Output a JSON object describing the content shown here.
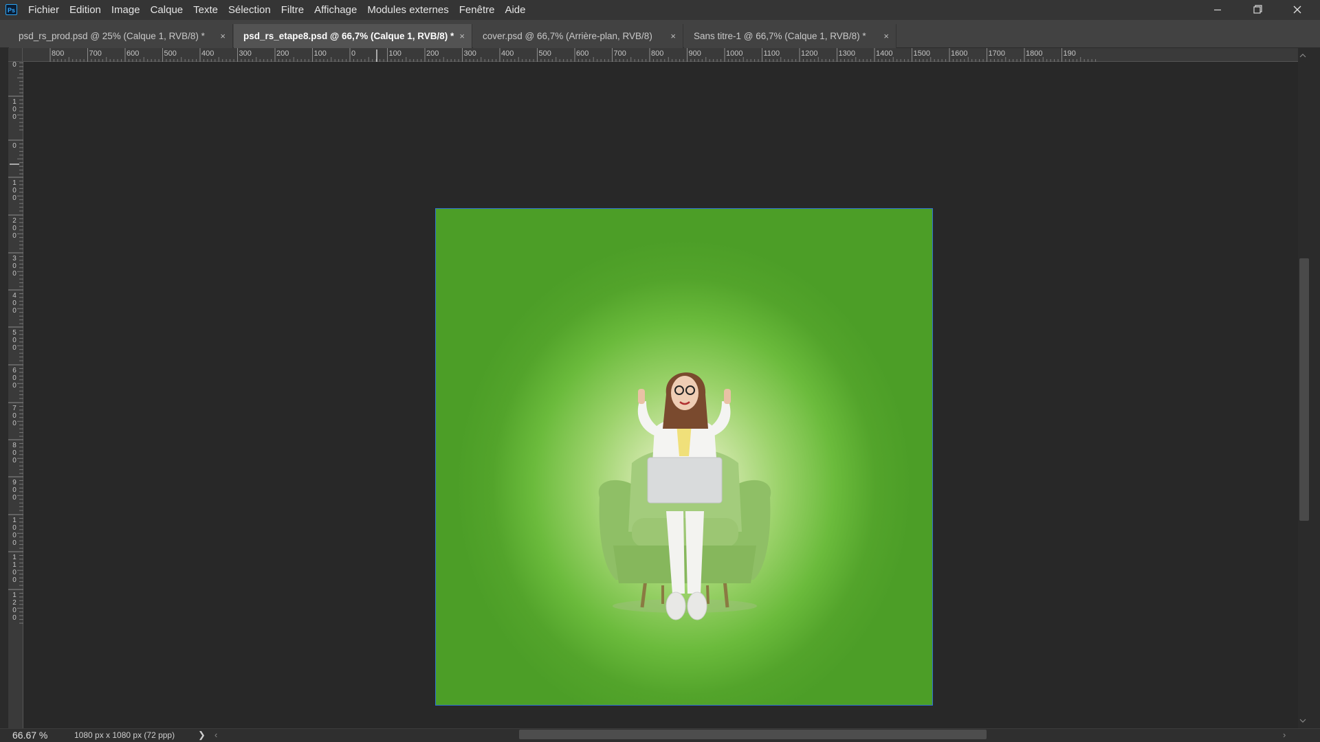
{
  "app": {
    "logo": "Ps"
  },
  "menu": [
    "Fichier",
    "Edition",
    "Image",
    "Calque",
    "Texte",
    "Sélection",
    "Filtre",
    "Affichage",
    "Modules externes",
    "Fenêtre",
    "Aide"
  ],
  "window_controls": {
    "minimize": "minimize-icon",
    "restore": "restore-icon",
    "close": "close-icon"
  },
  "tabs": [
    {
      "label": "psd_rs_prod.psd @ 25% (Calque 1, RVB/8) *",
      "active": false
    },
    {
      "label": "psd_rs_etape8.psd @ 66,7% (Calque 1, RVB/8) *",
      "active": true
    },
    {
      "label": "cover.psd @ 66,7% (Arrière-plan, RVB/8)",
      "active": false
    },
    {
      "label": "Sans titre-1 @ 66,7% (Calque 1, RVB/8) *",
      "active": false
    }
  ],
  "tab_close_glyph": "×",
  "ruler_h": [
    "800",
    "700",
    "600",
    "500",
    "400",
    "300",
    "200",
    "100",
    "0",
    "100",
    "200",
    "300",
    "400",
    "500",
    "600",
    "700",
    "800",
    "900",
    "1000",
    "1100",
    "1200",
    "1300",
    "1400",
    "1500",
    "1600",
    "1700",
    "1800",
    "190"
  ],
  "ruler_v": [
    "0",
    "100",
    "0",
    "100",
    "200",
    "300",
    "400",
    "500",
    "600",
    "700",
    "800",
    "900",
    "1000",
    "1100",
    "1200"
  ],
  "canvas": {
    "description_colors": {
      "edge": "#4c9e27",
      "center": "#eef5dc"
    }
  },
  "status": {
    "zoom": "66.67 %",
    "doc_size": "1080 px x 1080 px (72 ppp)",
    "arrow": "❯"
  },
  "scroll": {
    "left_arrow": "‹",
    "right_arrow": "›"
  },
  "colors": {
    "accent": "#31a8ff",
    "canvas_border": "#2f6fd6",
    "background": "#282828"
  }
}
